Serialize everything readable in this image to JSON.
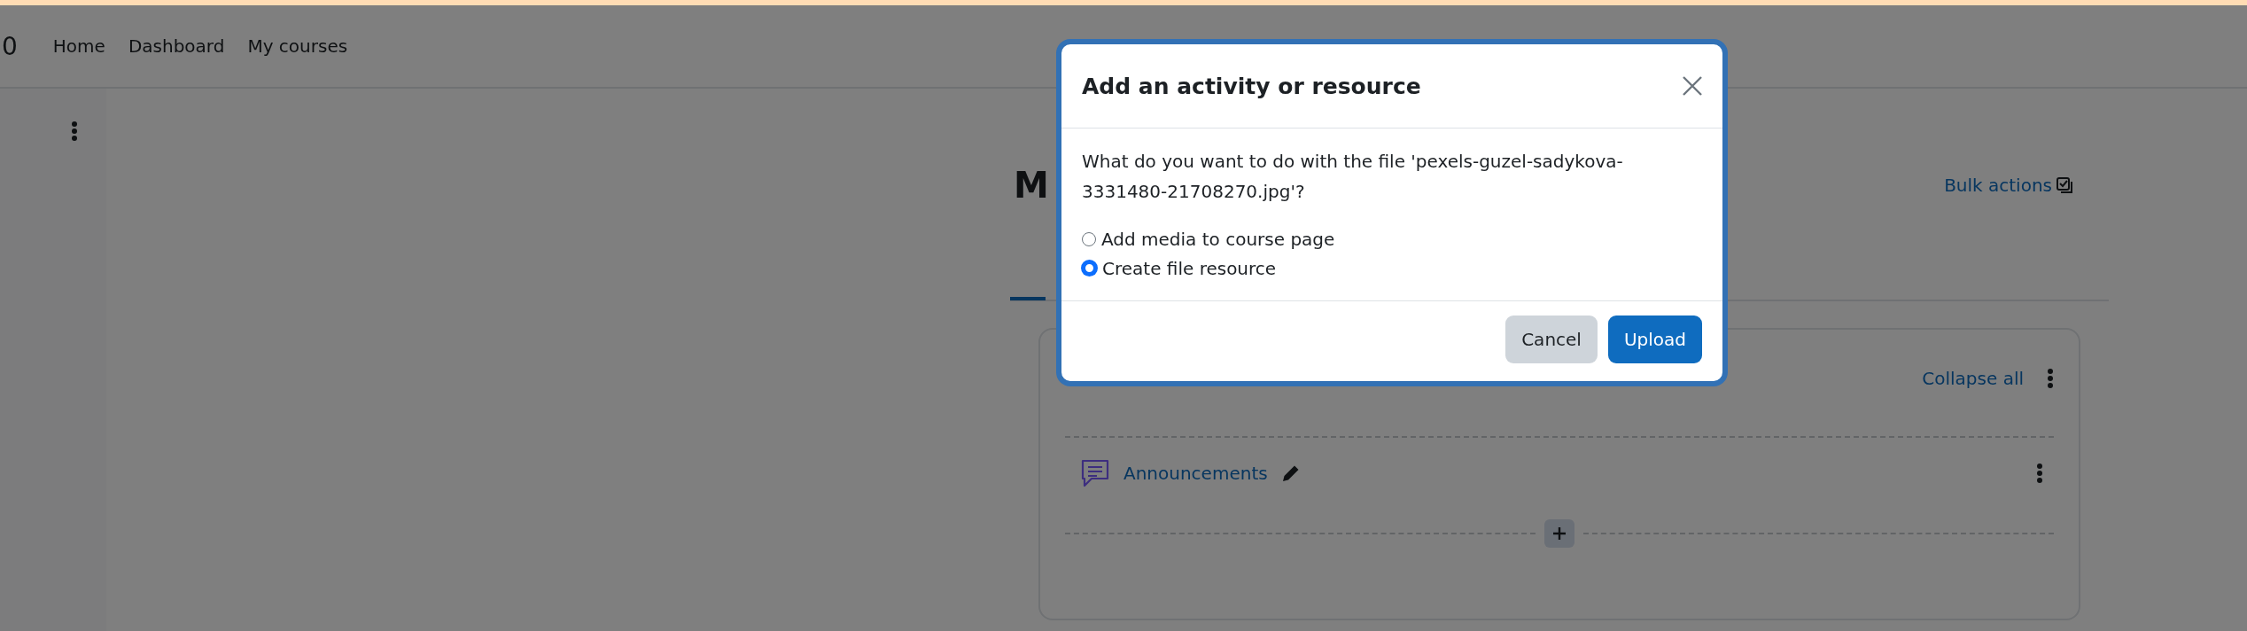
{
  "top_nav": {
    "site_name": "0",
    "links": [
      {
        "label": "Home"
      },
      {
        "label": "Dashboard"
      },
      {
        "label": "My courses"
      }
    ]
  },
  "page": {
    "heading": "M",
    "bulk_actions": "Bulk actions",
    "course_card": {
      "collapse_all": "Collapse all",
      "activities": [
        {
          "name": "Announcements"
        }
      ]
    }
  },
  "dialog": {
    "title": "Add an activity or resource",
    "message": "What do you want to do with the file 'pexels-guzel-sadykova-3331480-21708270.jpg'?",
    "options": [
      {
        "label": "Add media to course page",
        "selected": false
      },
      {
        "label": "Create file resource",
        "selected": true
      }
    ],
    "buttons": [
      {
        "label": "Cancel",
        "kind": "secondary"
      },
      {
        "label": "Upload",
        "kind": "primary"
      }
    ]
  }
}
